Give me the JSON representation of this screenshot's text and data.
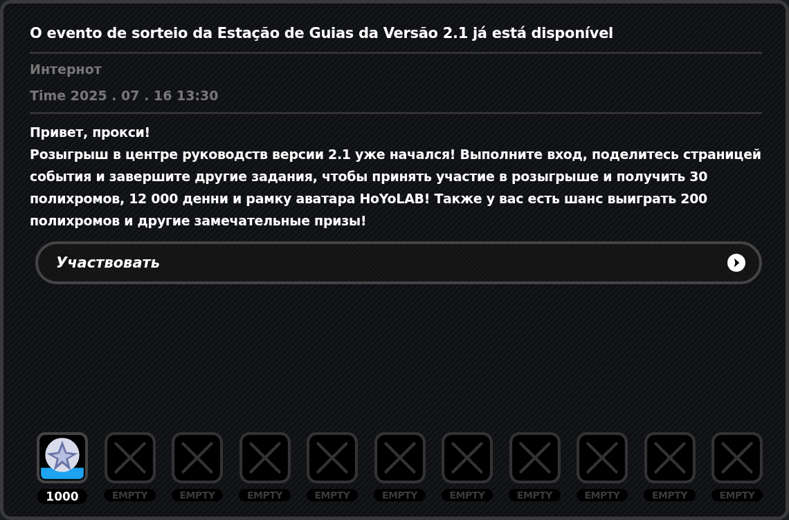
{
  "title": "O evento de sorteio da Estação de Guias da Versão 2.1 já está disponível",
  "sender": "Интернот",
  "time": "Time 2025 . 07 . 16   13:30",
  "greeting": "Привет, прокси!",
  "body": "Розыгрыш в центре руководств версии 2.1 уже начался! Выполните вход, поделитесь страницей события и завершите другие задания, чтобы принять участие в розыгрыше и получить 30 полихромов, 12 000 денни и рамку аватара HoYoLAB! Также у вас есть шанс выиграть 200 полихромов и другие замечательные призы!",
  "action_button": {
    "label": "Участвовать"
  },
  "rewards": [
    {
      "kind": "item",
      "label": "1000"
    },
    {
      "kind": "empty",
      "label": "EMPTY"
    },
    {
      "kind": "empty",
      "label": "EMPTY"
    },
    {
      "kind": "empty",
      "label": "EMPTY"
    },
    {
      "kind": "empty",
      "label": "EMPTY"
    },
    {
      "kind": "empty",
      "label": "EMPTY"
    },
    {
      "kind": "empty",
      "label": "EMPTY"
    },
    {
      "kind": "empty",
      "label": "EMPTY"
    },
    {
      "kind": "empty",
      "label": "EMPTY"
    },
    {
      "kind": "empty",
      "label": "EMPTY"
    },
    {
      "kind": "empty",
      "label": "EMPTY"
    }
  ]
}
